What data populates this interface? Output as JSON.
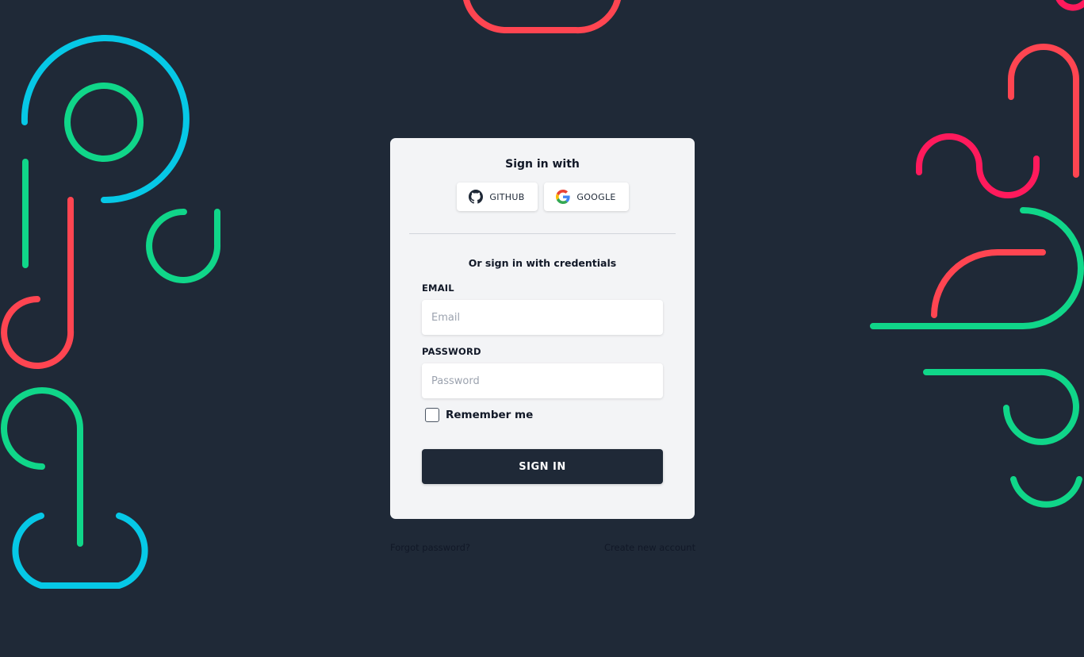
{
  "social": {
    "title": "Sign in with",
    "github_label": "GITHUB",
    "google_label": "GOOGLE"
  },
  "credentials": {
    "title": "Or sign in with credentials",
    "email_label": "EMAIL",
    "email_placeholder": "Email",
    "email_value": "",
    "password_label": "PASSWORD",
    "password_placeholder": "Password",
    "password_value": "",
    "remember_label": "Remember me",
    "remember_checked": false,
    "submit_label": "SIGN IN"
  },
  "links": {
    "forgot_password": "Forgot password?",
    "create_account": "Create new account"
  },
  "icons": {
    "github": "github-icon",
    "google": "google-icon"
  },
  "colors": {
    "background": "#1f2937",
    "card": "#f3f4f6",
    "primary_button": "#1f2937",
    "decor_cyan": "#06c8e6",
    "decor_green": "#10d689",
    "decor_red": "#ff4551",
    "decor_pink": "#ff1a5c"
  }
}
